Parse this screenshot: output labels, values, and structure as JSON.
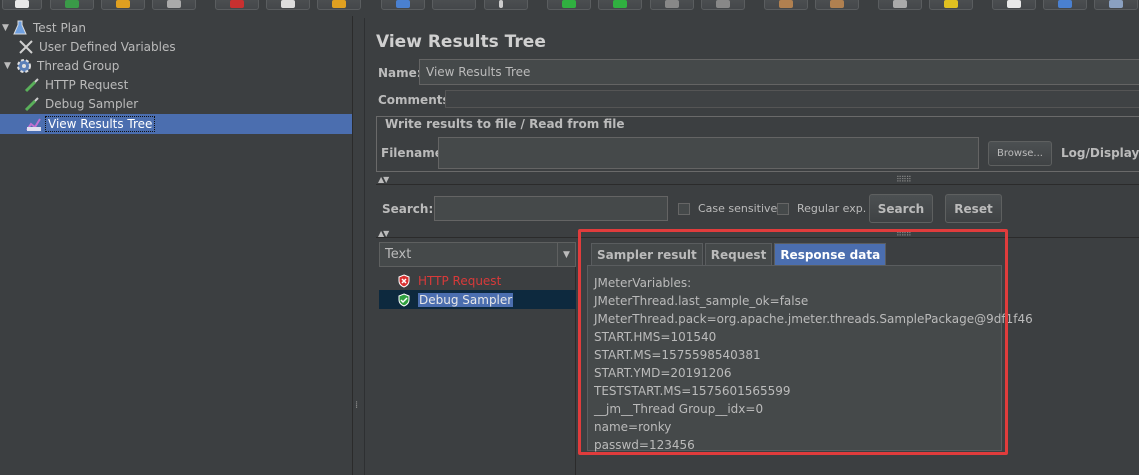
{
  "tree": {
    "items": [
      {
        "label": "Test Plan",
        "icon": "flask-icon"
      },
      {
        "label": "User Defined Variables",
        "icon": "wrench-icon"
      },
      {
        "label": "Thread Group",
        "icon": "gear-icon"
      },
      {
        "label": "HTTP Request",
        "icon": "pipette-icon"
      },
      {
        "label": "Debug Sampler",
        "icon": "pipette-icon"
      },
      {
        "label": "View Results Tree",
        "icon": "chart-icon"
      }
    ]
  },
  "panel": {
    "title": "View Results Tree",
    "name_label": "Name:",
    "name_value": "View Results Tree",
    "comments_label": "Comments:",
    "file_section_title": "Write results to file / Read from file",
    "filename_label": "Filename",
    "filename_value": "",
    "browse_label": "Browse...",
    "log_display_label": "Log/Display Or"
  },
  "search": {
    "label": "Search:",
    "value": "",
    "case_sensitive_label": "Case sensitive",
    "regex_label": "Regular exp.",
    "search_button": "Search",
    "reset_button": "Reset"
  },
  "results": {
    "renderer": "Text",
    "items": [
      {
        "label": "HTTP Request",
        "status": "error",
        "color": "#d83a3a"
      },
      {
        "label": "Debug Sampler",
        "status": "success",
        "color": "#bbbbbb"
      }
    ]
  },
  "tabs": [
    "Sampler result",
    "Request",
    "Response data"
  ],
  "active_tab": "Response data",
  "response_lines": [
    "JMeterVariables:",
    "JMeterThread.last_sample_ok=false",
    "JMeterThread.pack=org.apache.jmeter.threads.SamplePackage@9df1f46",
    "START.HMS=101540",
    "START.MS=1575598540381",
    "START.YMD=20191206",
    "TESTSTART.MS=1575601565599",
    "__jm__Thread Group__idx=0",
    "name=ronky",
    "passwd=123456"
  ],
  "colors": {
    "background": "#3c3f41",
    "selection": "#4b6eaf",
    "highlight_border": "#e03c3c",
    "error_text": "#d83a3a"
  }
}
